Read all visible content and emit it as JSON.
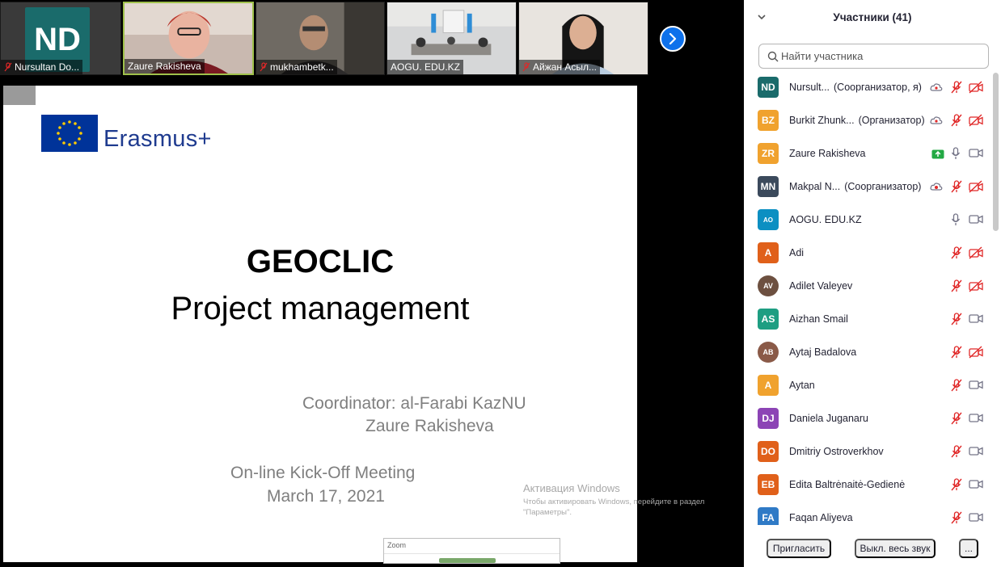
{
  "thumbnails": [
    {
      "name": "Nursultan Do...",
      "muted": true,
      "active": false,
      "avatar_initials": "ND"
    },
    {
      "name": "Zaure Rakisheva",
      "muted": false,
      "active": true
    },
    {
      "name": "mukhambetk...",
      "muted": true,
      "active": false
    },
    {
      "name": "AOGU. EDU.KZ",
      "muted": false,
      "active": false
    },
    {
      "name": "Айжан Асыл...",
      "muted": true,
      "active": false
    }
  ],
  "slide": {
    "logo_text": "Erasmus+",
    "title": "GEOCLIC",
    "subtitle": "Project management",
    "coordinator": "Coordinator: al-Farabi KazNU",
    "coordinator_name": "Zaure Rakisheva",
    "meeting": "On-line Kick-Off Meeting",
    "date": "March 17, 2021"
  },
  "windows_activation": {
    "title": "Активация Windows",
    "text": "Чтобы активировать Windows, перейдите в раздел \"Параметры\"."
  },
  "zoom_popup": {
    "title": "Zoom"
  },
  "panel": {
    "title": "Участники (41)",
    "search_placeholder": "Найти участника",
    "participants": [
      {
        "initials": "ND",
        "name": "Nursult...",
        "role": "(Соорганизатор, я)",
        "color": "#1a6b6b",
        "status": "cloud",
        "mic": "muted",
        "cam": "off"
      },
      {
        "initials": "BZ",
        "name": "Burkit Zhunk...",
        "role": "(Организатор)",
        "color": "#f0a22e",
        "status": "cloud",
        "mic": "muted",
        "cam": "off"
      },
      {
        "initials": "ZR",
        "name": "Zaure Rakisheva",
        "role": "",
        "color": "#f0a22e",
        "status": "share",
        "mic": "on",
        "cam": "on"
      },
      {
        "initials": "MN",
        "name": "Makpal N...",
        "role": "(Соорганизатор)",
        "color": "#3b4a5c",
        "status": "record",
        "mic": "muted",
        "cam": "off"
      },
      {
        "initials": "AO",
        "name": "AOGU. EDU.KZ",
        "role": "",
        "color": "#0c8fc2",
        "status": "",
        "mic": "on",
        "cam": "on"
      },
      {
        "initials": "A",
        "name": "Adi",
        "role": "",
        "color": "#e0601a",
        "status": "",
        "mic": "muted",
        "cam": "off"
      },
      {
        "initials": "AV",
        "name": "Adilet Valeyev",
        "role": "",
        "color": "#6d5040",
        "status": "",
        "mic": "muted",
        "cam": "off"
      },
      {
        "initials": "AS",
        "name": "Aizhan Smail",
        "role": "",
        "color": "#1e9e82",
        "status": "",
        "mic": "muted",
        "cam": "on"
      },
      {
        "initials": "AB",
        "name": "Aytaj Badalova",
        "role": "",
        "color": "#8a5a48",
        "status": "",
        "mic": "muted",
        "cam": "off"
      },
      {
        "initials": "A",
        "name": "Aytan",
        "role": "",
        "color": "#f0a22e",
        "status": "",
        "mic": "muted",
        "cam": "on"
      },
      {
        "initials": "DJ",
        "name": "Daniela Juganaru",
        "role": "",
        "color": "#8c44b5",
        "status": "",
        "mic": "muted",
        "cam": "on"
      },
      {
        "initials": "DO",
        "name": "Dmitriy Ostroverkhov",
        "role": "",
        "color": "#e0601a",
        "status": "",
        "mic": "muted",
        "cam": "on"
      },
      {
        "initials": "EB",
        "name": "Edita Baltrėnaitė-Gedienė",
        "role": "",
        "color": "#e0601a",
        "status": "",
        "mic": "muted",
        "cam": "on"
      },
      {
        "initials": "FA",
        "name": "Faqan Aliyeva",
        "role": "",
        "color": "#2f7ac6",
        "status": "",
        "mic": "muted",
        "cam": "on"
      }
    ],
    "footer": {
      "invite": "Пригласить",
      "mute_all": "Выкл. весь звук",
      "more": "..."
    }
  },
  "colors": {
    "muted_red": "#e02828",
    "icon_gray": "#747487",
    "accent_blue": "#0e71eb"
  }
}
